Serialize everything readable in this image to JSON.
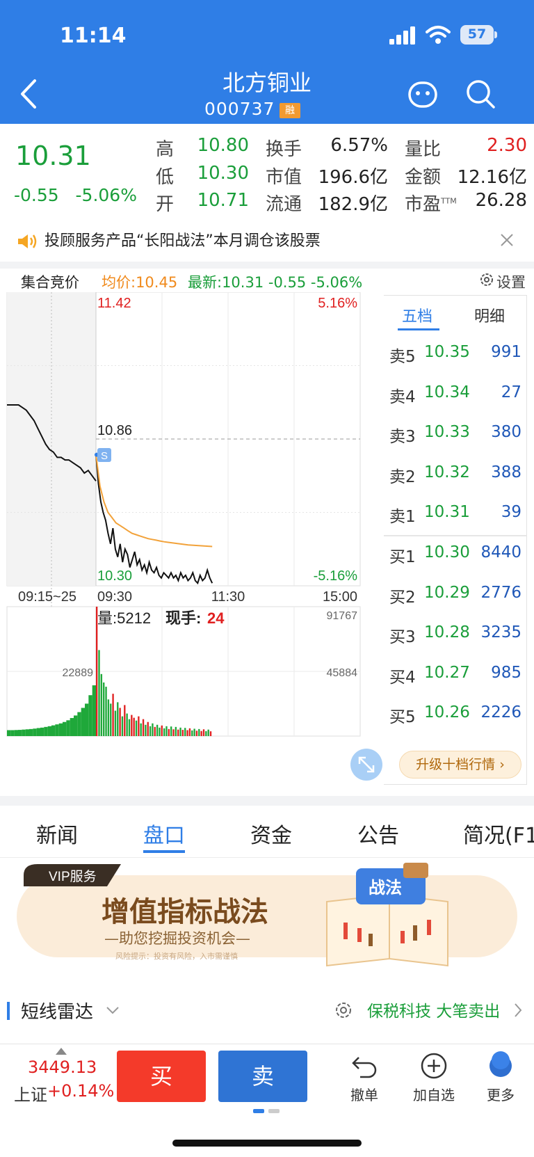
{
  "status": {
    "time": "11:14",
    "battery": "57"
  },
  "header": {
    "title": "北方铜业",
    "code": "000737",
    "badge": "融"
  },
  "quote": {
    "price": "10.31",
    "change": "-0.55",
    "change_pct": "-5.06%",
    "high_label": "高",
    "high": "10.80",
    "low_label": "低",
    "low": "10.30",
    "open_label": "开",
    "open": "10.71",
    "turnover_label": "换手",
    "turnover": "6.57%",
    "mktcap_label": "市值",
    "mktcap": "196.6亿",
    "float_label": "流通",
    "float": "182.9亿",
    "volratio_label": "量比",
    "volratio": "2.30",
    "amount_label": "金额",
    "amount": "12.16亿",
    "pe_label": "市盈",
    "pe_sup": "TTM",
    "pe": "26.28",
    "colors": {
      "up": "#e02020",
      "down": "#1a9e3a"
    }
  },
  "notice": {
    "text": "投顾服务产品“长阳战法”本月调仓该股票"
  },
  "chart_info": {
    "auction": "集合竞价",
    "avg": "均价:10.45",
    "latest": "最新:10.31 -0.55 -5.06%",
    "settings": "设置"
  },
  "chart_data": {
    "type": "line",
    "y_top": "11.42",
    "y_top_pct": "5.16%",
    "y_mid": "10.86",
    "y_bottom": "10.30",
    "y_bottom_pct": "-5.16%",
    "marker": "S",
    "time_labels": [
      "09:15~25",
      "09:30",
      "11:30",
      "15:00"
    ],
    "ylim": [
      10.3,
      11.42
    ],
    "prev_close": 10.86,
    "auction_price": [
      10.99,
      10.99,
      10.99,
      10.99,
      10.98,
      10.97,
      10.95,
      10.93,
      10.9,
      10.87,
      10.84,
      10.82,
      10.81,
      10.79,
      10.79,
      10.78,
      10.78,
      10.77,
      10.76,
      10.75,
      10.73,
      10.74,
      10.72,
      10.7
    ],
    "price": [
      10.8,
      10.69,
      10.62,
      10.58,
      10.55,
      10.5,
      10.46,
      10.52,
      10.44,
      10.41,
      10.46,
      10.39,
      10.44,
      10.42,
      10.37,
      10.4,
      10.43,
      10.38,
      10.4,
      10.36,
      10.38,
      10.35,
      10.39,
      10.36,
      10.35,
      10.37,
      10.34,
      10.33,
      10.35,
      10.34,
      10.33,
      10.35,
      10.33,
      10.34,
      10.32,
      10.35,
      10.33,
      10.34,
      10.32,
      10.33,
      10.35,
      10.32,
      10.31,
      10.34,
      10.32,
      10.33,
      10.36,
      10.33,
      10.31
    ],
    "avg_price": [
      10.8,
      10.68,
      10.62,
      10.58,
      10.56,
      10.54,
      10.53,
      10.52,
      10.51,
      10.5,
      10.495,
      10.49,
      10.485,
      10.48,
      10.477,
      10.474,
      10.471,
      10.468,
      10.466,
      10.464,
      10.462,
      10.46,
      10.458,
      10.456,
      10.455,
      10.454,
      10.453,
      10.452,
      10.451,
      10.45
    ],
    "volume_title": "量:5212",
    "hand_label": "现手:",
    "hand_value": "24",
    "vol_max_label": "91767",
    "vol_mid_label": "45884",
    "auction_vol_label": "22889",
    "vol_max": 91767,
    "auction_volume": [
      4200,
      4200,
      4300,
      4400,
      4600,
      4800,
      5000,
      5300,
      5700,
      6000,
      6500,
      7000,
      7600,
      8300,
      9000,
      10000,
      11200,
      12800,
      14600,
      17000,
      20000,
      23000,
      29000,
      36000
    ],
    "volume": [
      91767,
      61000,
      44000,
      38000,
      35000,
      26000,
      23000,
      30000,
      18000,
      24000,
      20000,
      14000,
      22000,
      16000,
      12000,
      15000,
      13000,
      11000,
      14000,
      9000,
      12000,
      8000,
      10000,
      7000,
      9000,
      6500,
      8000,
      6000,
      7500,
      5500,
      7000,
      5000,
      6800,
      4800,
      6500,
      4600,
      6000,
      4400,
      5800,
      4200,
      5500,
      4000,
      5200,
      3800,
      5000,
      3600,
      4800,
      3500,
      4600,
      3400
    ]
  },
  "order_book": {
    "tab_five": "五档",
    "tab_detail": "明细",
    "asks": [
      {
        "label": "卖5",
        "price": "10.35",
        "vol": "991"
      },
      {
        "label": "卖4",
        "price": "10.34",
        "vol": "27"
      },
      {
        "label": "卖3",
        "price": "10.33",
        "vol": "380"
      },
      {
        "label": "卖2",
        "price": "10.32",
        "vol": "388"
      },
      {
        "label": "卖1",
        "price": "10.31",
        "vol": "39"
      }
    ],
    "bids": [
      {
        "label": "买1",
        "price": "10.30",
        "vol": "8440"
      },
      {
        "label": "买2",
        "price": "10.29",
        "vol": "2776"
      },
      {
        "label": "买3",
        "price": "10.28",
        "vol": "3235"
      },
      {
        "label": "买4",
        "price": "10.27",
        "vol": "985"
      },
      {
        "label": "买5",
        "price": "10.26",
        "vol": "2226"
      }
    ],
    "upgrade": "升级十档行情 ›"
  },
  "tabs": [
    "新闻",
    "盘口",
    "资金",
    "公告",
    "简况(F1"
  ],
  "banner": {
    "vip": "VIP服务",
    "title": "增值指标战法",
    "subtitle": "—助您挖掘投资机会—",
    "disclaimer": "风险提示：投资有风险，入市需谨慎",
    "book_label": "战法"
  },
  "radar": {
    "title": "短线雷达",
    "message": "保税科技 大笔卖出"
  },
  "bottom": {
    "index_value": "3449.13",
    "index_name": "上证",
    "index_change": "+0.14%",
    "buy": "买",
    "sell": "卖",
    "cancel": "撤单",
    "add_watch": "加自选",
    "more": "更多"
  }
}
